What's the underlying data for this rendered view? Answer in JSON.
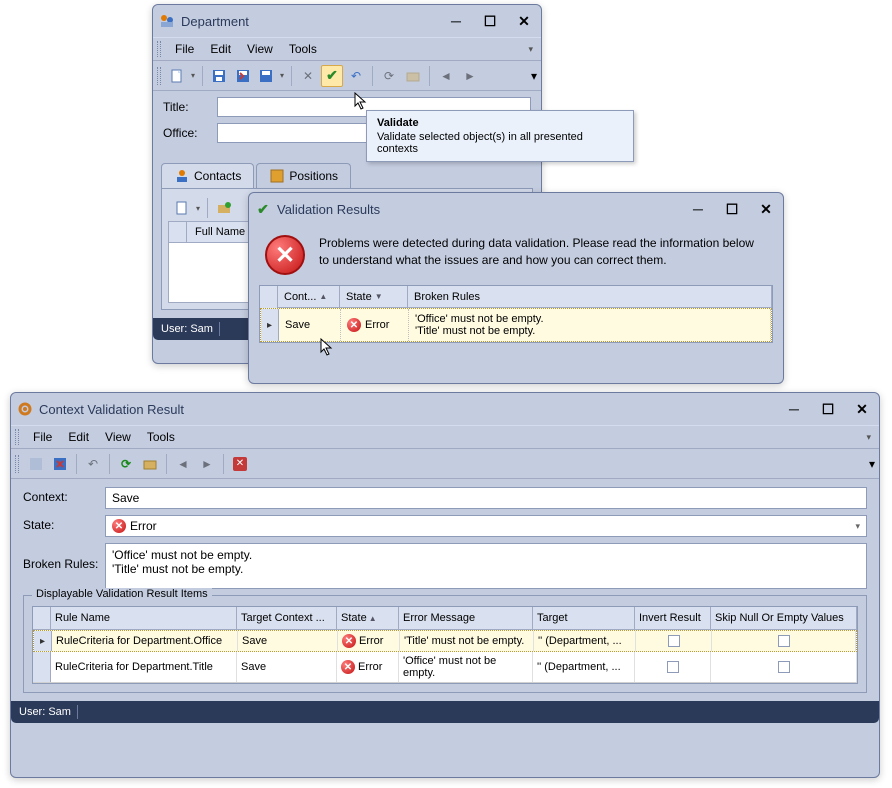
{
  "department": {
    "title": "Department",
    "menu": {
      "file": "File",
      "edit": "Edit",
      "view": "View",
      "tools": "Tools"
    },
    "form": {
      "title_label": "Title:",
      "title_value": "",
      "office_label": "Office:",
      "office_value": ""
    },
    "tabs": {
      "contacts": "Contacts",
      "positions": "Positions"
    },
    "grid": {
      "full_name": "Full Name"
    },
    "status_user": "User: Sam",
    "tooltip": {
      "title": "Validate",
      "text": "Validate selected object(s) in all presented contexts"
    }
  },
  "validation_results": {
    "title": "Validation Results",
    "message": "Problems were detected during data validation. Please read the information below to understand what the issues are and how you can correct them.",
    "grid": {
      "col_context": "Cont...",
      "col_state": "State",
      "col_broken": "Broken Rules",
      "row": {
        "context": "Save",
        "state": "Error",
        "broken": "'Office' must not be empty.\n'Title' must not be empty."
      }
    }
  },
  "context_validation": {
    "title": "Context Validation Result",
    "menu": {
      "file": "File",
      "edit": "Edit",
      "view": "View",
      "tools": "Tools"
    },
    "form": {
      "context_label": "Context:",
      "context_value": "Save",
      "state_label": "State:",
      "state_value": "Error",
      "broken_rules_label": "Broken Rules:",
      "broken_rules_value": "'Office' must not be empty.\n'Title' must not be empty."
    },
    "group": {
      "title": "Displayable Validation Result Items",
      "cols": {
        "rule_name": "Rule Name",
        "target_context": "Target Context ...",
        "state": "State",
        "error_message": "Error Message",
        "target": "Target",
        "invert_result": "Invert Result",
        "skip_null": "Skip Null Or Empty Values"
      },
      "rows": [
        {
          "rule_name": "RuleCriteria for Department.Office",
          "target_context": "Save",
          "state": "Error",
          "error_message": "'Title' must not be empty.",
          "target": "'' (Department, ...",
          "invert": false,
          "skip": false
        },
        {
          "rule_name": "RuleCriteria for Department.Title",
          "target_context": "Save",
          "state": "Error",
          "error_message": "'Office' must not be empty.",
          "target": "'' (Department, ...",
          "invert": false,
          "skip": false
        }
      ]
    },
    "status_user": "User: Sam"
  }
}
